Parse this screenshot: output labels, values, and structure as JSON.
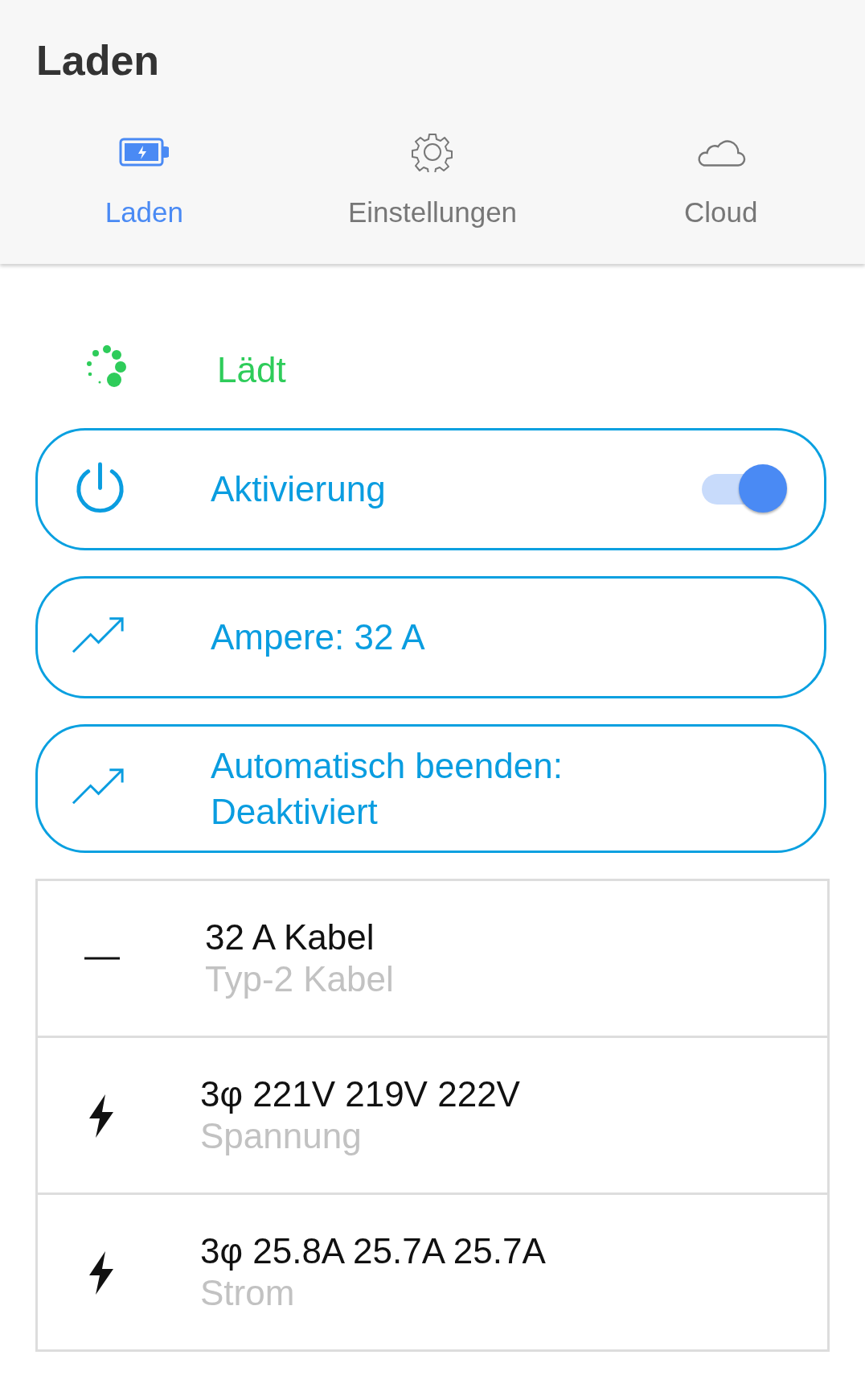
{
  "app_bar": {
    "title": "Laden"
  },
  "tabs": [
    {
      "label": "Laden",
      "kind": "battery",
      "selected": true
    },
    {
      "label": "Einstellungen",
      "kind": "gear",
      "selected": false
    },
    {
      "label": "Cloud",
      "kind": "cloud",
      "selected": false
    }
  ],
  "status": {
    "label": "Lädt"
  },
  "controls": [
    {
      "kind": "toggle",
      "label": "Aktivierung",
      "on": true
    },
    {
      "kind": "value",
      "label": "Ampere: 32 A"
    },
    {
      "kind": "value",
      "label": "Automatisch beenden: Deaktiviert"
    }
  ],
  "info": [
    {
      "kind": "cable",
      "title": "32 A Kabel",
      "subtitle": "Typ-2 Kabel"
    },
    {
      "kind": "electric",
      "title": "3φ 221V 219V 222V",
      "subtitle": "Spannung"
    },
    {
      "kind": "electric",
      "title": "3φ 25.8A 25.7A 25.7A",
      "subtitle": "Strom"
    }
  ]
}
